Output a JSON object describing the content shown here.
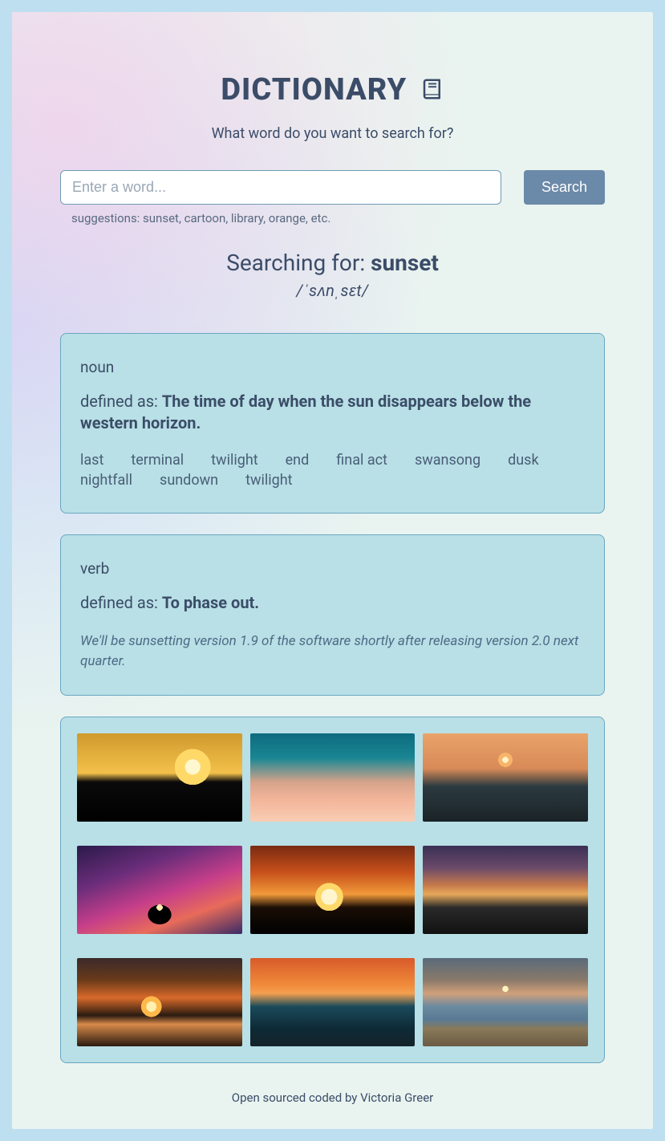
{
  "header": {
    "title": "DICTIONARY",
    "subtitle": "What word do you want to search for?"
  },
  "search": {
    "placeholder": "Enter a word...",
    "button": "Search",
    "suggestions": "suggestions: sunset, cartoon, library, orange, etc."
  },
  "result": {
    "prefix": "Searching for: ",
    "word": "sunset",
    "phonetic": "/ˈsʌnˌsɛt/"
  },
  "entries": [
    {
      "pos": "noun",
      "def_label": "defined as: ",
      "definition": "The time of day when the sun disappears below the western horizon.",
      "synonyms": [
        "last",
        "terminal",
        "twilight",
        "end",
        "final act",
        "swansong",
        "dusk",
        "nightfall",
        "sundown",
        "twilight"
      ],
      "example": ""
    },
    {
      "pos": "verb",
      "def_label": "defined as: ",
      "definition": "To phase out.",
      "synonyms": [],
      "example": "We'll be sunsetting version 1.9 of the software shortly after releasing version 2.0 next quarter."
    }
  ],
  "footer": "Open sourced coded by Victoria Greer"
}
